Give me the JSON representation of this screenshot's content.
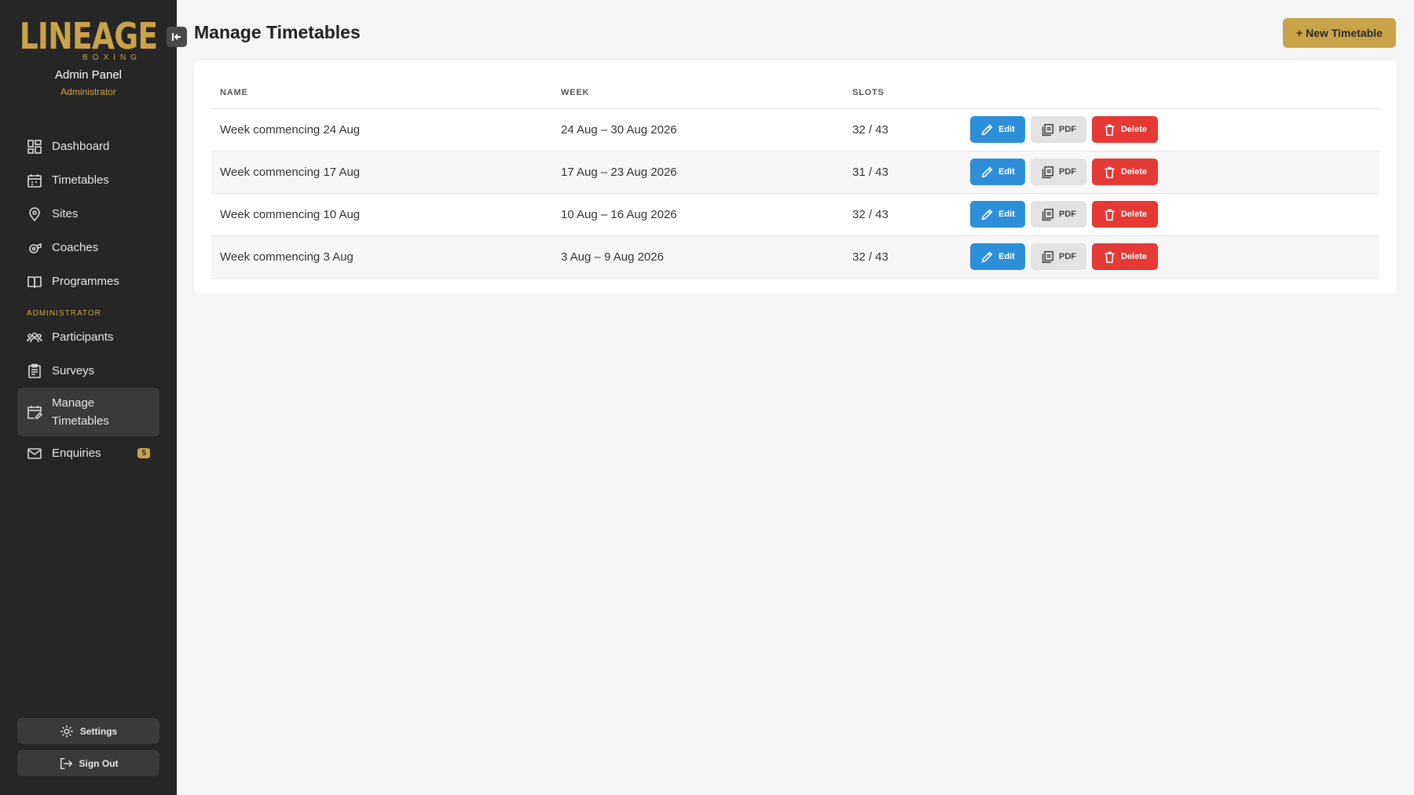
{
  "sidebar": {
    "logo": {
      "word": "LINEAGE",
      "sub": "BOXING"
    },
    "admin_title": "Admin Panel",
    "admin_role": "Administrator",
    "items": [
      {
        "label": "Dashboard",
        "icon": "dashboard-icon"
      },
      {
        "label": "Timetables",
        "icon": "calendar-icon"
      },
      {
        "label": "Sites",
        "icon": "map-pin-icon"
      },
      {
        "label": "Coaches",
        "icon": "whistle-icon"
      },
      {
        "label": "Programmes",
        "icon": "book-icon"
      }
    ],
    "section_label": "ADMINISTRATOR",
    "admin_items": [
      {
        "label": "Participants",
        "icon": "users-icon"
      },
      {
        "label": "Surveys",
        "icon": "clipboard-icon"
      },
      {
        "label": "Manage Timetables",
        "icon": "calendar-edit-icon",
        "active": true
      },
      {
        "label": "Enquiries",
        "icon": "mail-icon",
        "badge": "5"
      }
    ],
    "settings_label": "Settings",
    "signout_label": "Sign Out"
  },
  "header": {
    "title": "Manage Timetables",
    "new_button": "+ New Timetable"
  },
  "table": {
    "columns": [
      "NAME",
      "WEEK",
      "SLOTS",
      ""
    ],
    "action_labels": {
      "edit": "Edit",
      "pdf": "PDF",
      "delete": "Delete"
    },
    "rows": [
      {
        "name": "Week commencing 24 Aug",
        "week": "24 Aug – 30 Aug 2026",
        "slots": "32 / 43"
      },
      {
        "name": "Week commencing 17 Aug",
        "week": "17 Aug – 23 Aug 2026",
        "slots": "31 / 43"
      },
      {
        "name": "Week commencing 10 Aug",
        "week": "10 Aug – 16 Aug 2026",
        "slots": "32 / 43"
      },
      {
        "name": "Week commencing 3 Aug",
        "week": "3 Aug – 9 Aug 2026",
        "slots": "32 / 43"
      }
    ]
  },
  "colors": {
    "accent": "#c9a34a",
    "sidebar_bg": "#262626",
    "edit": "#2d8fd8",
    "delete": "#e53935"
  }
}
